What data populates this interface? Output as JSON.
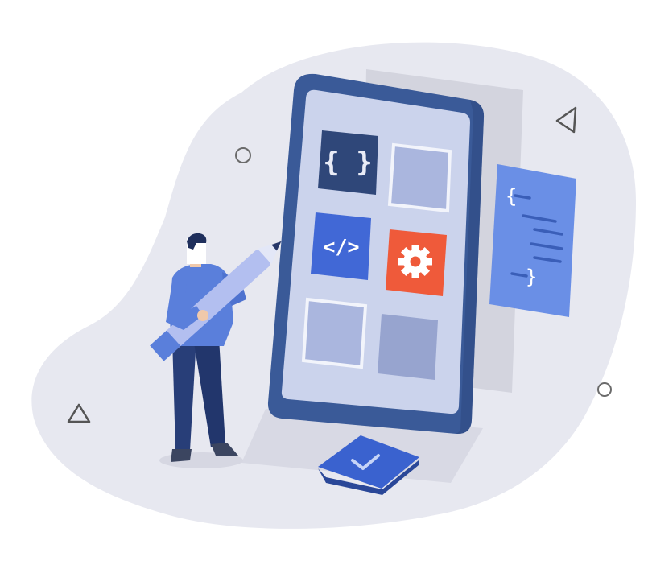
{
  "colors": {
    "background": "#ffffff",
    "blob": "#e7e8f0",
    "back_panel": "#d3d4de",
    "phone_frame": "#3a5a98",
    "phone_screen": "#cbd3ec",
    "tile_dark": "#2f4779",
    "tile_blue": "#4168d6",
    "tile_red": "#ef5a3a",
    "tile_light": "#aab6de",
    "code_card": "#6a8fe6",
    "check_button": "#3a62cf",
    "person_shirt": "#5a7fdb",
    "person_pants": "#283e78",
    "pencil_body": "#b3bff0",
    "pencil_tip": "#263668",
    "outline_shapes": "#6b6b6b"
  },
  "icons": {
    "braces_tile": "braces-icon",
    "code_tile": "code-tag-icon",
    "settings_tile": "gear-icon",
    "check_button": "checkmark-icon",
    "code_card": "code-lines-icon",
    "floating_shapes": [
      "circle-outline-icon",
      "triangle-outline-icon"
    ]
  },
  "tiles": {
    "braces": "{ }",
    "code": "</>"
  },
  "code_card": {
    "open_brace": "{",
    "close_brace": "}"
  }
}
